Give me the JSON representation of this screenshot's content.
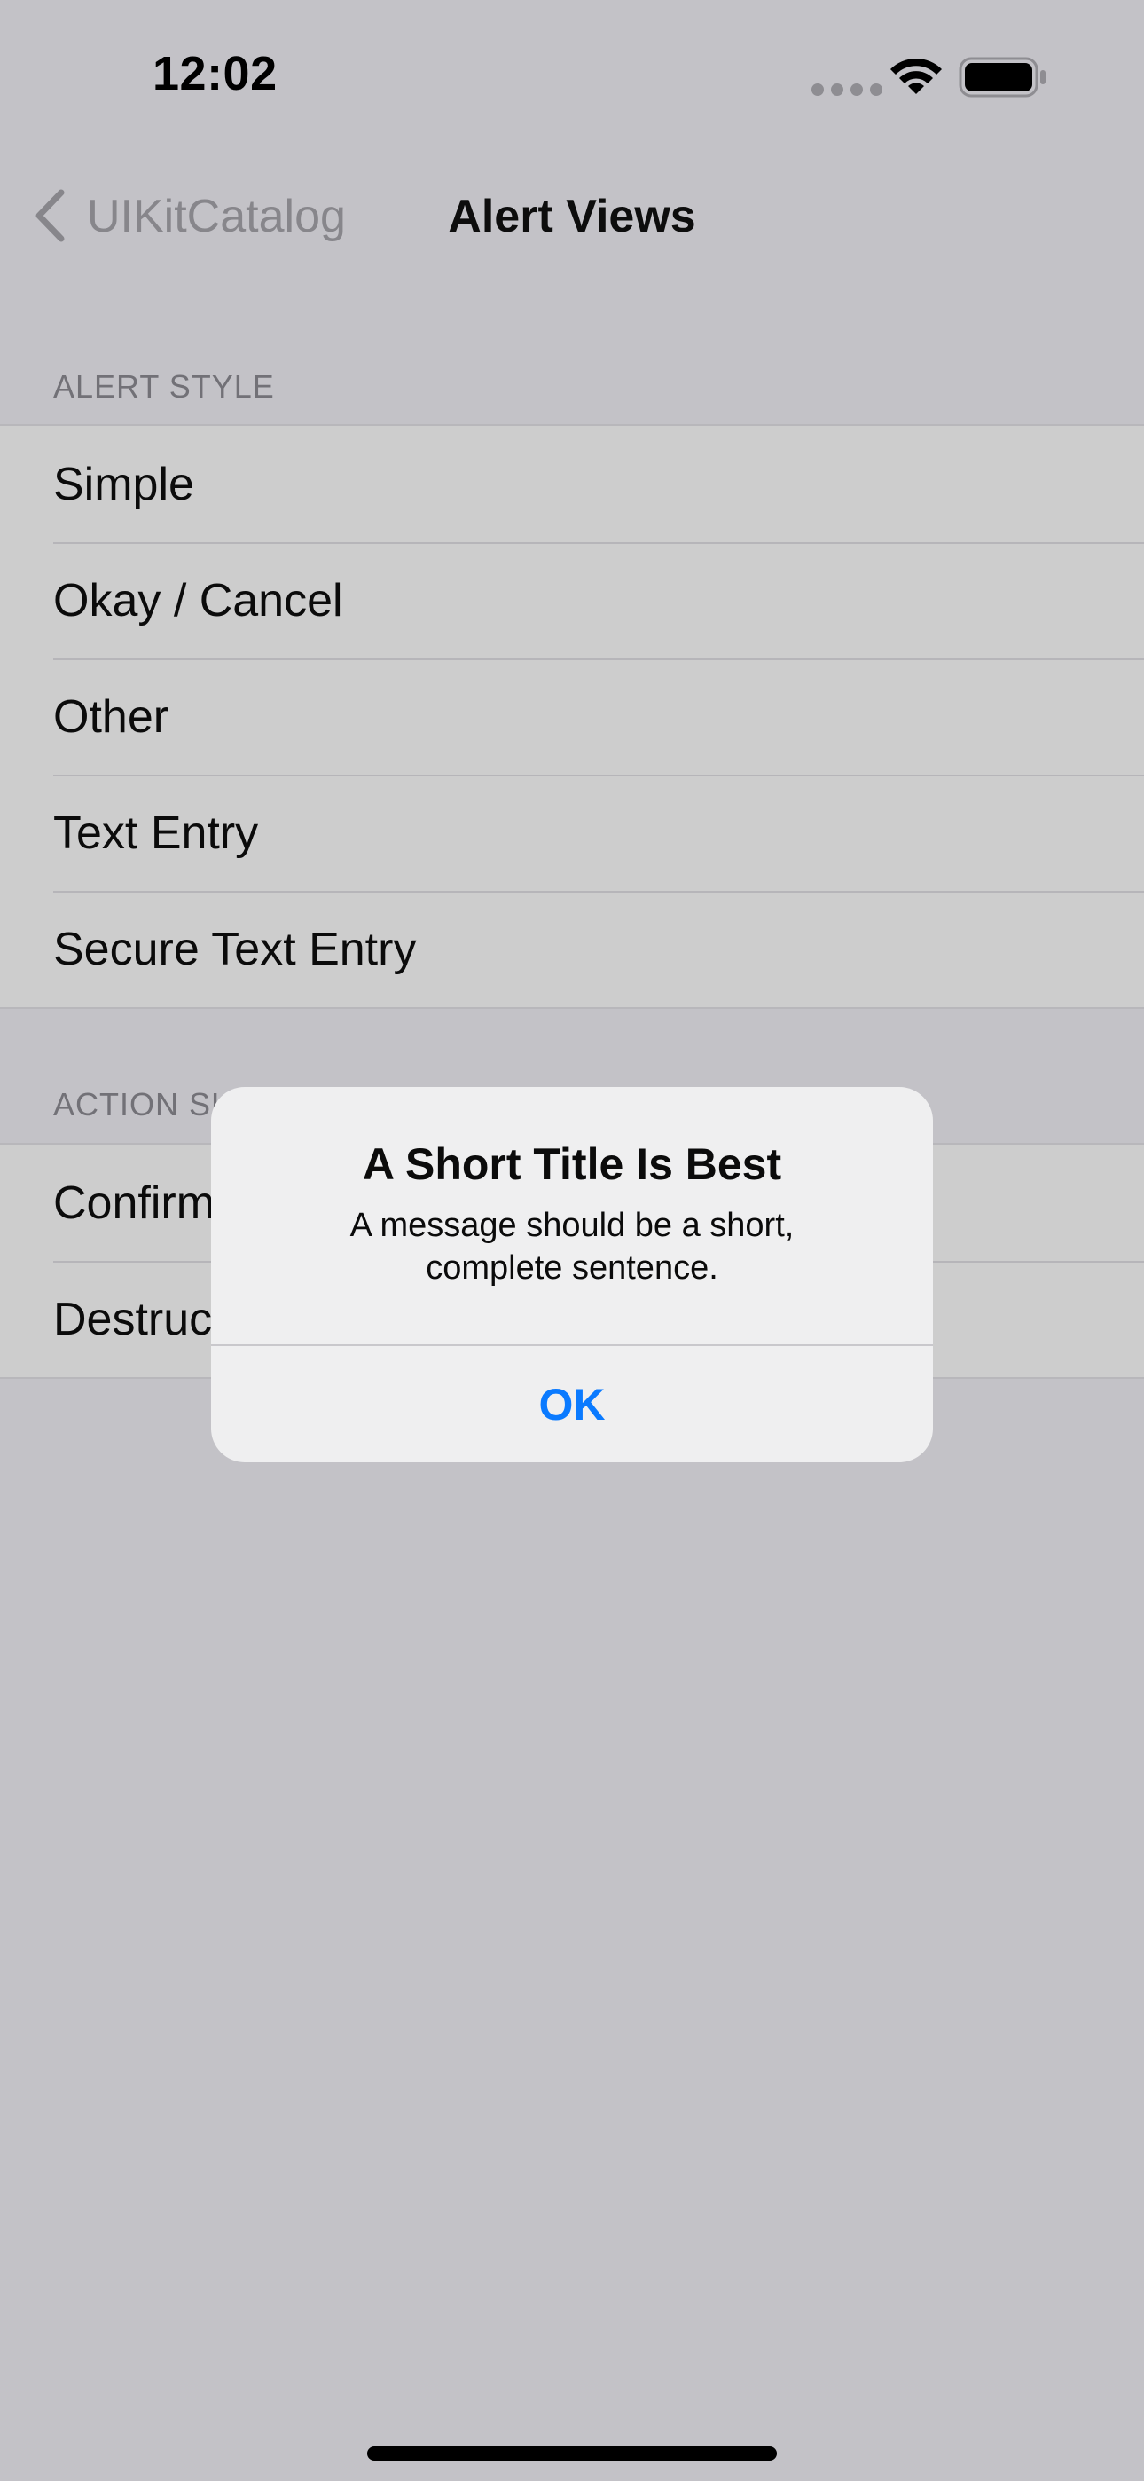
{
  "status_bar": {
    "time": "12:02"
  },
  "nav": {
    "back_label": "UIKitCatalog",
    "title": "Alert Views"
  },
  "sections": [
    {
      "header": "ALERT STYLE",
      "items": [
        "Simple",
        "Okay / Cancel",
        "Other",
        "Text Entry",
        "Secure Text Entry"
      ]
    },
    {
      "header": "ACTION SHEET STYLE",
      "items": [
        "Confirm / Cancel",
        "Destructive"
      ]
    }
  ],
  "alert": {
    "title": "A Short Title Is Best",
    "message": "A message should be a short, complete sentence.",
    "ok_label": "OK"
  },
  "colors": {
    "accent": "#0a7aff",
    "dimmed_background": "#c3c2c7"
  }
}
